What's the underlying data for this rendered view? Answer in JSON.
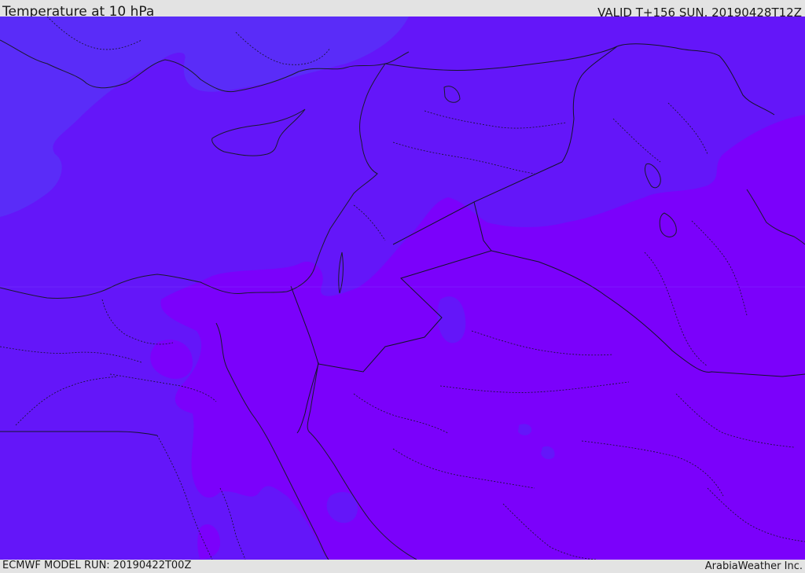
{
  "header": {
    "title": "Temperature at 10 hPa",
    "valid_time": "VALID T+156 SUN. 20190428T12Z"
  },
  "footer": {
    "model_run": "ECMWF MODEL RUN: 20190422T00Z",
    "credit": "ArabiaWeather Inc."
  },
  "map": {
    "region": "Eastern Mediterranean, Levant, Egypt, Northern Arabia",
    "field": "temperature",
    "pressure_level_hpa": 10,
    "colors": {
      "coldest_band": "#5a2cf8",
      "middle_band": "#6416f9",
      "warmest_band": "#7b01fb",
      "coastline": "#1a1a2e",
      "border": "#14142a"
    }
  }
}
